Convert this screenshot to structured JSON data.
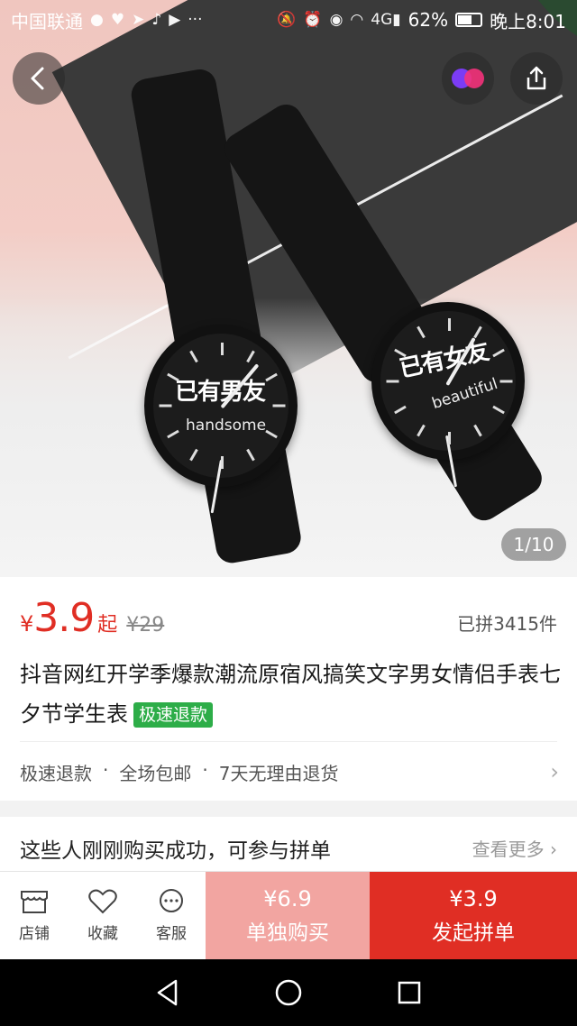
{
  "status_bar": {
    "carrier": "中国联通",
    "signal": "4G",
    "battery": "62%",
    "time": "晚上8:01"
  },
  "hero": {
    "pager": "1/10",
    "watch_left_brand": "已有男友",
    "watch_left_word": "handsome",
    "watch_right_brand": "已有女友",
    "watch_right_word": "beautiful"
  },
  "product": {
    "currency": "¥",
    "price": "3.9",
    "price_suffix": "起",
    "original_price": "¥29",
    "sold": "已拼3415件",
    "title": "抖音网红开学季爆款潮流原宿风搞笑文字男女情侣手表七夕节学生表",
    "badge": "极速退款"
  },
  "services": {
    "items": [
      "极速退款",
      "·",
      "全场包邮",
      "·",
      "7天无理由退货"
    ]
  },
  "groups": {
    "title": "这些人刚刚购买成功，可参与拼单",
    "more": "查看更多"
  },
  "bottom_bar": {
    "store": "店铺",
    "favorite": "收藏",
    "service": "客服",
    "alone_price": "¥6.9",
    "alone_label": "单独购买",
    "group_price": "¥3.9",
    "group_label": "发起拼单"
  },
  "colors": {
    "accent": "#e02e24",
    "accent_light": "#f2a5a1",
    "badge_green": "#2dad48"
  }
}
